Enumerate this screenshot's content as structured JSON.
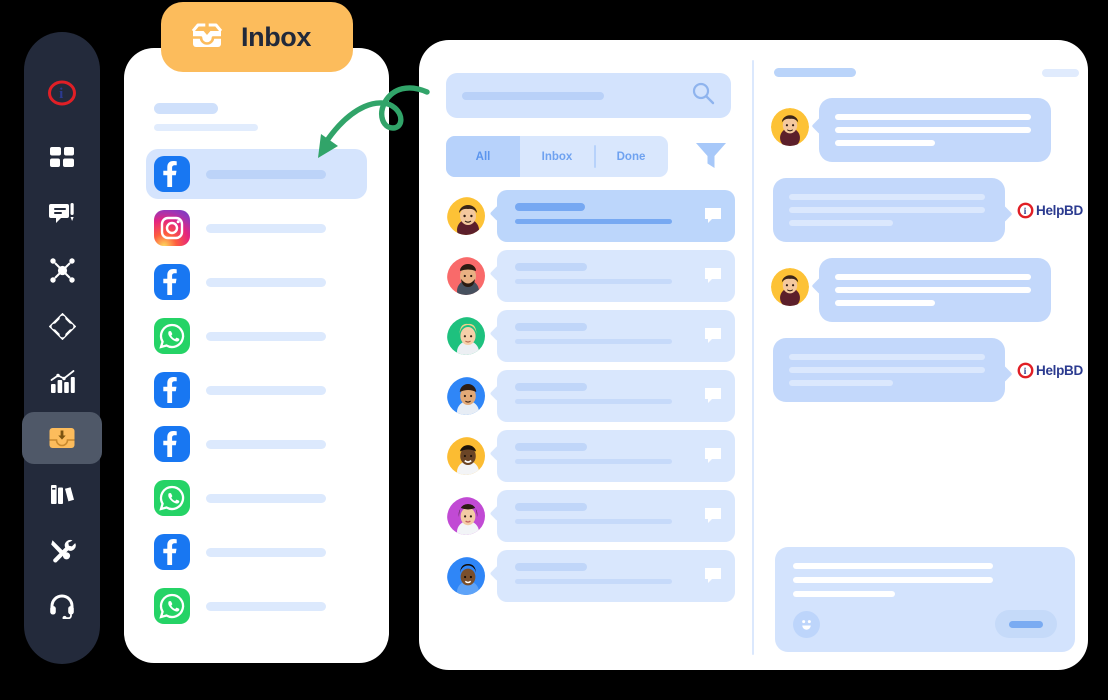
{
  "colors": {
    "sidebar_bg": "#232a3b",
    "sidebar_active": "#4f5868",
    "accent_orange": "#fcbc5c",
    "brand_red": "#e01f26",
    "brand_navy": "#2b3a8f",
    "panel_bg": "#ffffff",
    "page_bg": "#000000",
    "skeleton_blue": "#d9e7fd",
    "skeleton_blue_dark": "#bcd6fb",
    "arrow_green": "#31a469",
    "facebook": "#1877f2",
    "whatsapp": "#25d366",
    "instagram": "#e5257e"
  },
  "sidebar": {
    "items": [
      {
        "name": "app-logo",
        "icon": "helpbd-logo-icon",
        "active": false
      },
      {
        "name": "dashboard",
        "icon": "grid-dashboard-icon",
        "active": false
      },
      {
        "name": "conversations",
        "icon": "chat-alert-icon",
        "active": false
      },
      {
        "name": "automation",
        "icon": "network-nodes-icon",
        "active": false
      },
      {
        "name": "integrations",
        "icon": "diamond-compass-icon",
        "active": false
      },
      {
        "name": "reports",
        "icon": "bar-chart-trend-icon",
        "active": false
      },
      {
        "name": "inbox",
        "icon": "inbox-download-icon",
        "active": true
      },
      {
        "name": "knowledge-base",
        "icon": "books-icon",
        "active": false
      },
      {
        "name": "tools",
        "icon": "wrench-screwdriver-icon",
        "active": false
      },
      {
        "name": "support",
        "icon": "headset-icon",
        "active": false
      }
    ]
  },
  "inbox_tab": {
    "label": "Inbox",
    "icon": "inbox-download-icon"
  },
  "channel_panel": {
    "header": {
      "title_skeleton": true,
      "subtitle_skeleton": true
    },
    "items": [
      {
        "channel": "facebook",
        "selected": true
      },
      {
        "channel": "instagram",
        "selected": false
      },
      {
        "channel": "facebook",
        "selected": false
      },
      {
        "channel": "whatsapp",
        "selected": false
      },
      {
        "channel": "facebook",
        "selected": false
      },
      {
        "channel": "facebook",
        "selected": false
      },
      {
        "channel": "whatsapp",
        "selected": false
      },
      {
        "channel": "facebook",
        "selected": false
      },
      {
        "channel": "whatsapp",
        "selected": false
      }
    ]
  },
  "main": {
    "search": {
      "placeholder": "",
      "icon": "search-icon"
    },
    "filter_icon": "funnel-filter-icon",
    "tabs": [
      {
        "label": "All",
        "active": true
      },
      {
        "label": "Inbox",
        "active": false
      },
      {
        "label": "Done",
        "active": false
      }
    ],
    "conversations": [
      {
        "avatar": "young-man-yellow",
        "unread": true
      },
      {
        "avatar": "bearded-man-red",
        "unread": false
      },
      {
        "avatar": "blonde-woman-green",
        "unread": false
      },
      {
        "avatar": "man-blue",
        "unread": false
      },
      {
        "avatar": "man-yellow",
        "unread": false
      },
      {
        "avatar": "woman-purple",
        "unread": false
      },
      {
        "avatar": "child-blue",
        "unread": false
      }
    ]
  },
  "chat": {
    "header": {
      "name_skeleton": true,
      "meta_skeleton": true
    },
    "messages": [
      {
        "direction": "inbound",
        "avatar": "young-man-yellow",
        "lines": 3,
        "brand": null
      },
      {
        "direction": "outbound",
        "avatar": null,
        "lines": 3,
        "brand": "HelpBD"
      },
      {
        "direction": "inbound",
        "avatar": "young-man-yellow",
        "lines": 3,
        "brand": null
      },
      {
        "direction": "outbound",
        "avatar": null,
        "lines": 3,
        "brand": "HelpBD"
      }
    ],
    "brand_name": "HelpBD",
    "composer": {
      "lines": 3,
      "emoji_icon": "smiley-face-icon",
      "send_label": ""
    }
  },
  "annotation": {
    "arrow": "curly-arrow-pointing-to-selected-channel",
    "color": "#31a469"
  }
}
